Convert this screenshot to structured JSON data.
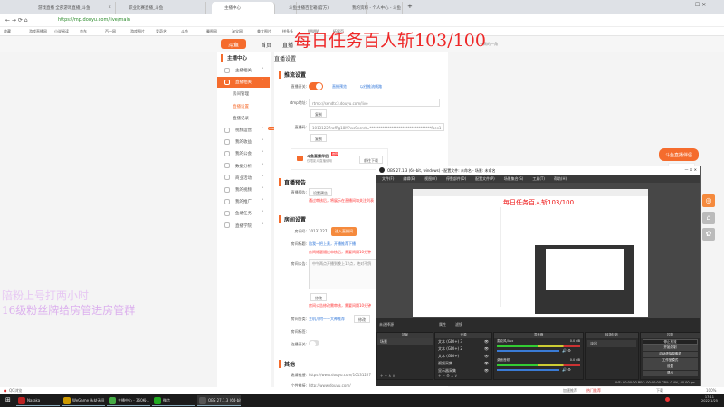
{
  "browser": {
    "tabs": [
      "游戏直播 全部游戏直播_斗鱼",
      "职业比赛直播_斗鱼",
      "我的资料 - 个人中心 - 斗鱼",
      "主播中心",
      "斗鱼主播百宝箱(官方)",
      "我的资料 - 个人中心 - 斗鱼"
    ],
    "url": "https://mp.douyu.com/live/main",
    "bookmarks": [
      "收藏",
      "游戏直播网",
      "小说阅读",
      "京东",
      "百一网",
      "游戏图片",
      "爱奇艺",
      "斗鱼",
      "晕图网",
      "淘宝网",
      "美文图片",
      "拼多多",
      "WWW",
      "拓展页"
    ],
    "status_left": "QQ浏览",
    "status_right": [
      "加速推荐",
      "热门推荐",
      "下载",
      "100%"
    ]
  },
  "site": {
    "nav": [
      "首页",
      "直播",
      "分类",
      "活动",
      "一周的一角"
    ]
  },
  "banner": "每日任务百人斩103/100",
  "overlay": {
    "line1": "陪粉上号打两小时",
    "line2": "16级粉丝牌给房管进房管群"
  },
  "sidebar": {
    "title": "主播中心",
    "items": [
      {
        "label": "主播相关",
        "type": "item"
      },
      {
        "label": "直播相关",
        "type": "active"
      },
      {
        "label": "房间管理",
        "type": "sub"
      },
      {
        "label": "直播设置",
        "type": "sub-active"
      },
      {
        "label": "直播记录",
        "type": "sub"
      },
      {
        "label": "视频运营",
        "type": "item",
        "badge": "new"
      },
      {
        "label": "我的收益",
        "type": "item"
      },
      {
        "label": "我的公会",
        "type": "item"
      },
      {
        "label": "数据分析",
        "type": "item"
      },
      {
        "label": "商业活动",
        "type": "item"
      },
      {
        "label": "我的视频",
        "type": "item"
      },
      {
        "label": "我的推广",
        "type": "item"
      },
      {
        "label": "鱼塘任务",
        "type": "item"
      },
      {
        "label": "直播学院",
        "type": "item"
      }
    ]
  },
  "main": {
    "title": "直播设置",
    "push": {
      "title": "推流设置",
      "switch_label": "直播开关:",
      "preview": "直播预览",
      "lines": "以往推流线路",
      "rtmp_label": "rtmp地址:",
      "rtmp": "rtmp://sendtc3.douyu.com/live",
      "copy": "复制",
      "code_label": "直播码:",
      "code": "10131227rafRg18M?wsSecret=**********************************fbes1",
      "app_title": "斗鱼直播伴侣",
      "app_sub": "仅限影片直播使用",
      "app_tag": "推荐",
      "download": "前往下载"
    },
    "notice": {
      "title": "直播预告",
      "label": "直播预告:",
      "button": "设置预告",
      "hint": "通过审核后，将展示在直播间和关注列表"
    },
    "room": {
      "title": "房间设置",
      "id_label": "房间号:",
      "id": "10131227",
      "enter": "进入直播间",
      "title_label": "房间标题:",
      "room_title": "陪我一把上黄，开播推荐下播",
      "title_hint": "房间标题通过审核后，需要间隔10分钟",
      "ann_label": "房间公告:",
      "announcement": "中午两点开播到晚上12点，绝对不鸽",
      "modify": "修改",
      "ann_hint": "房间公告修改需审核，需要间隔10分钟",
      "cat_label": "房间分类:",
      "category": "主机几何——大神推荐",
      "tag_label": "房间标签:",
      "switch_label": "连播开关:"
    },
    "other": {
      "title": "其他",
      "invite_label": "邀请链接:",
      "invite": "https://www.douyu.com/10131227",
      "custom_label": "个性链接:",
      "custom": "http://www.douyu.com/"
    }
  },
  "obs": {
    "title": "OBS 27.1.3 (64-bit, windows) - 配置文件: 未命名 - 场景: 未命名",
    "menu": [
      "文件(F)",
      "编辑(E)",
      "视图(V)",
      "停靠部件(D)",
      "配置文件(P)",
      "场景集合(S)",
      "工具(T)",
      "帮助(H)"
    ],
    "preview_banner": "每日任务百人斩103/100",
    "no_source": "未选择源",
    "props": "属性",
    "filters": "滤镜",
    "docks": {
      "scenes": "场景",
      "sources": "来源",
      "mixer": "混音器",
      "transitions": "转场特效",
      "controls": "控制"
    },
    "scenes": [
      "场景"
    ],
    "sources": [
      "文本 (GDI+) 3",
      "文本 (GDI+) 2",
      "文本 (GDI+)",
      "视频采集",
      "显示器采集"
    ],
    "mixer": [
      {
        "name": "麦克风/Aux",
        "db": "0.0 dB"
      },
      {
        "name": "桌面音频",
        "db": "0.0 dB"
      }
    ],
    "transition": "淡出",
    "controls": [
      "停止推流",
      "开始录制",
      "启动虚拟摄像机",
      "工作室模式",
      "设置",
      "退出"
    ],
    "statusbar": "LIVE: 00:00:00  REC: 00:00:00  CPU: 0.4%, 60.00 fps"
  },
  "widget": {
    "title": "斗鱼直播伴侣"
  },
  "taskbar": {
    "apps": [
      "Naraka",
      "WeGame 永劫无间",
      "主播中心 - 360极...",
      "微信",
      "OBS 27.1.3 (64-bit..."
    ],
    "time": "17:11",
    "date": "2022/1/25"
  },
  "colors": {
    "accent": "#f56c2d",
    "banner": "#e11111"
  }
}
